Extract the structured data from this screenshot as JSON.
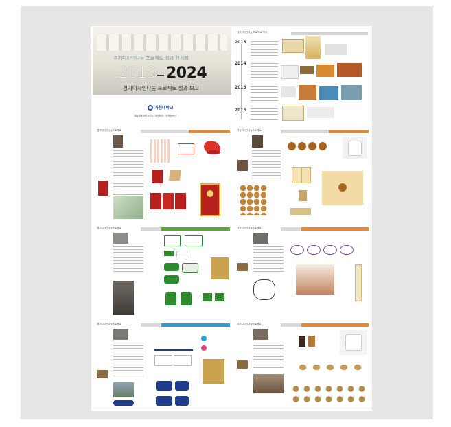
{
  "cover": {
    "title_line": "경기디자인나눔 프로젝트 성과 전시회",
    "year_start": "2013",
    "year_end": "2024",
    "subtitle": "경기디자인나눔 프로젝트 성과 보고",
    "logo_text": "가천대학교",
    "footer_text": "예술체육대학 시각디자인학과 · 산학협력단"
  },
  "timeline": {
    "header": "경기디자인나눔 프로젝트 역사",
    "years": [
      "2013",
      "2014",
      "2015",
      "2016"
    ]
  },
  "pages": {
    "p1_header": "경기디자인나눔프로젝트",
    "p2_header": "경기디자인나눔프로젝트",
    "p3_header": "경기디자인나눔프로젝트",
    "p4_header": "경기디자인나눔프로젝트",
    "p5_header": "경기디자인나눔프로젝트",
    "p6_header": "경기디자인나눔프로젝트"
  },
  "colors": {
    "orange_bar": "#e8872f",
    "green_bar": "#5aa637",
    "blue_bar": "#2a9fd6",
    "gray_bar": "#c9c9c9",
    "red_pack": "#b8201e",
    "green_brand": "#2f8a2e",
    "navy_brand": "#1f3d8c"
  }
}
